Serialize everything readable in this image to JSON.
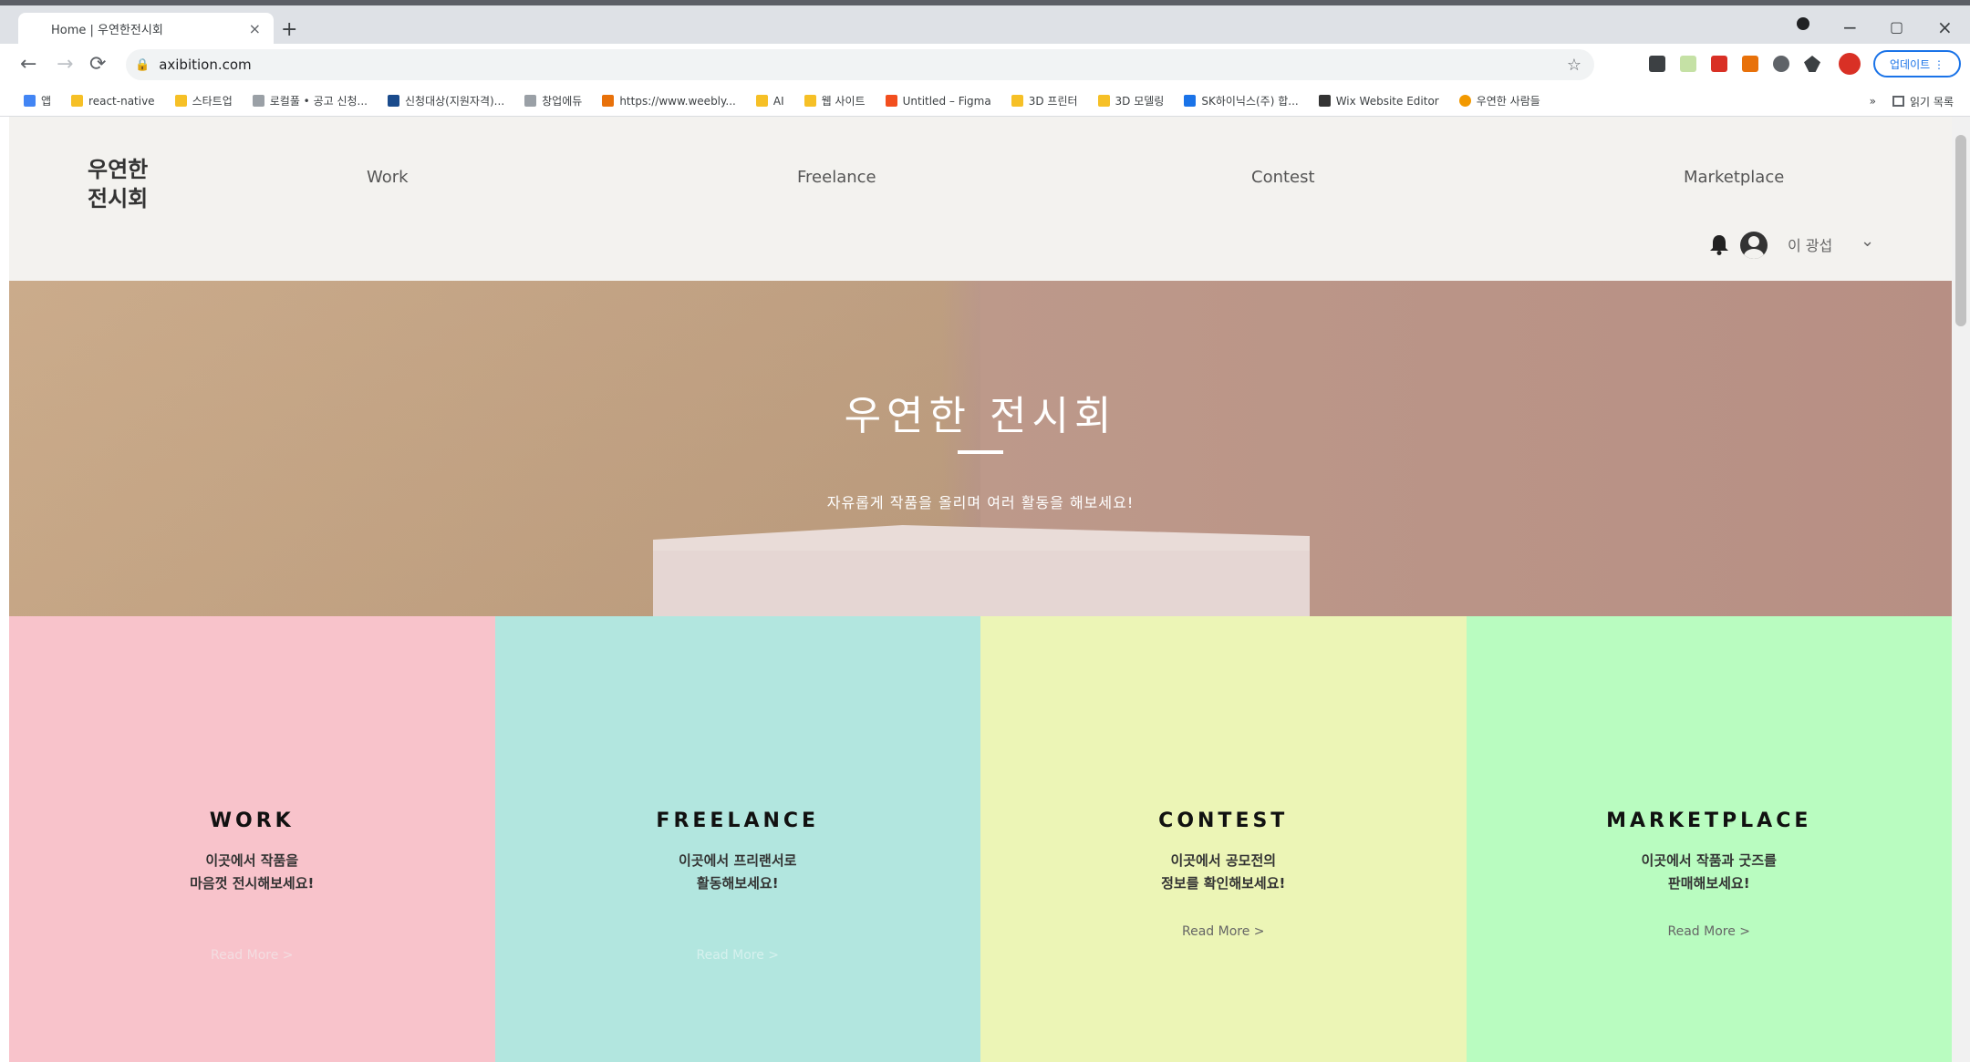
{
  "browser": {
    "tab_title": "Home | 우연한전시회",
    "tab_close": "×",
    "new_tab": "+",
    "url": "axibition.com",
    "profile_label": "업데이트 ⋮",
    "window": {
      "minimize": "−",
      "maximize": "▢",
      "close": "×"
    },
    "bookmarks": [
      {
        "label": "앱",
        "color": "#4285f4"
      },
      {
        "label": "react-native",
        "color": "#f6c026"
      },
      {
        "label": "스타트업",
        "color": "#f6c026"
      },
      {
        "label": "로컬풀 • 공고 신청...",
        "color": "#9aa0a6"
      },
      {
        "label": "신청대상(지원자격)...",
        "color": "#1a4b8c"
      },
      {
        "label": "창업에듀",
        "color": "#9aa0a6"
      },
      {
        "label": "https://www.weebly...",
        "color": "#e8710a"
      },
      {
        "label": "AI",
        "color": "#f6c026"
      },
      {
        "label": "웹 사이트",
        "color": "#f6c026"
      },
      {
        "label": "Untitled – Figma",
        "color": "#f24e1e"
      },
      {
        "label": "3D 프린터",
        "color": "#f6c026"
      },
      {
        "label": "3D 모델링",
        "color": "#f6c026"
      },
      {
        "label": "SK하이닉스(주) 합...",
        "color": "#1a73e8"
      },
      {
        "label": "Wix Website Editor",
        "color": "#333333"
      },
      {
        "label": "우연한 사람들",
        "color": "#f29900"
      }
    ],
    "bookmarks_more": "»",
    "reading_list": "읽기 목록"
  },
  "site": {
    "logo": "우연한 전시회",
    "nav": [
      "Work",
      "Freelance",
      "Contest",
      "Marketplace"
    ],
    "user_name": "이 광섭",
    "caret": "⌄"
  },
  "hero": {
    "title": "우연한 전시회",
    "subtitle": "자유롭게 작품을 올리며 여러 활동을 해보세요!"
  },
  "cards": [
    {
      "title": "WORK",
      "line1": "이곳에서 작품을",
      "line2": "마음껏 전시해보세요!",
      "more": "Read More >",
      "bg": "#f8c3cb",
      "more_color": "#f3dde1"
    },
    {
      "title": "FREELANCE",
      "line1": "이곳에서 프리랜서로",
      "line2": "활동해보세요!",
      "more": "Read More >",
      "bg": "#b2e6df",
      "more_color": "#d6f1ee"
    },
    {
      "title": "CONTEST",
      "line1": "이곳에서 공모전의",
      "line2": "정보를 확인해보세요!",
      "more": "Read More >",
      "bg": "#ecf5b6",
      "more_color": "#666666"
    },
    {
      "title": "MARKETPLACE",
      "line1": "이곳에서 작품과 굿즈를",
      "line2": "판매해보세요!",
      "more": "Read More >",
      "bg": "#b9fcc0",
      "more_color": "#666666"
    }
  ]
}
